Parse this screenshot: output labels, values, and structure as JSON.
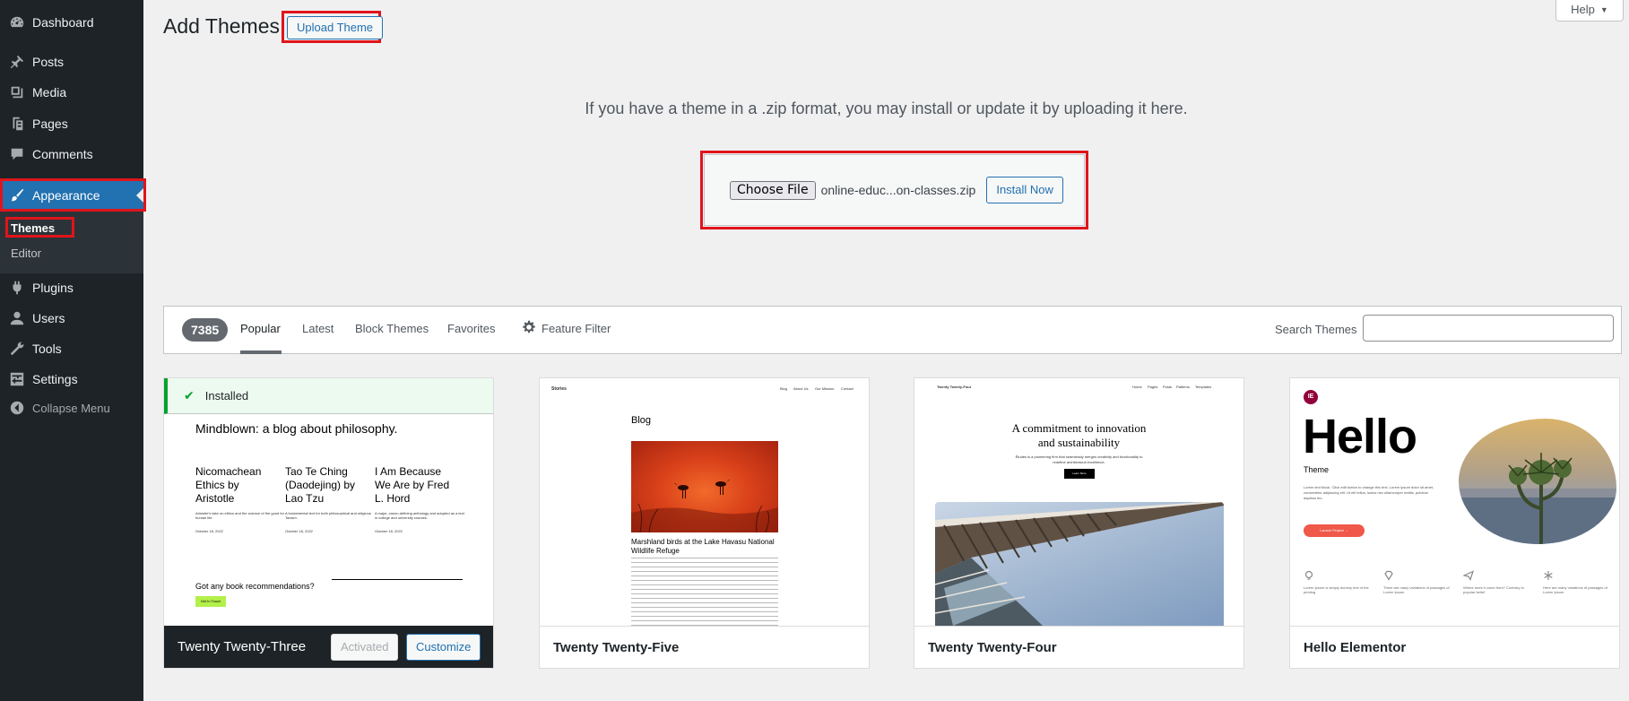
{
  "sidebar": {
    "items": [
      {
        "id": "dashboard",
        "label": "Dashboard",
        "icon": "dashboard-icon"
      },
      {
        "id": "posts",
        "label": "Posts",
        "icon": "pin-icon"
      },
      {
        "id": "media",
        "label": "Media",
        "icon": "media-icon"
      },
      {
        "id": "pages",
        "label": "Pages",
        "icon": "pages-icon"
      },
      {
        "id": "comments",
        "label": "Comments",
        "icon": "comment-icon"
      },
      {
        "id": "appearance",
        "label": "Appearance",
        "icon": "paintbrush-icon"
      },
      {
        "id": "plugins",
        "label": "Plugins",
        "icon": "plugin-icon"
      },
      {
        "id": "users",
        "label": "Users",
        "icon": "user-icon"
      },
      {
        "id": "tools",
        "label": "Tools",
        "icon": "wrench-icon"
      },
      {
        "id": "settings",
        "label": "Settings",
        "icon": "settings-icon"
      },
      {
        "id": "collapse",
        "label": "Collapse Menu",
        "icon": "collapse-icon"
      }
    ],
    "submenu": {
      "themes": "Themes",
      "editor": "Editor"
    }
  },
  "header": {
    "title": "Add Themes",
    "upload_label": "Upload Theme",
    "help_label": "Help"
  },
  "upload": {
    "description": "If you have a theme in a .zip format, you may install or update it by uploading it here.",
    "choose_label": "Choose File",
    "file_name": "online-educ...on-classes.zip",
    "install_label": "Install Now"
  },
  "filters": {
    "count": "7385",
    "tabs": [
      "Popular",
      "Latest",
      "Block Themes",
      "Favorites"
    ],
    "feature_filter": "Feature Filter",
    "search_label": "Search Themes",
    "search_value": ""
  },
  "themes": [
    {
      "name": "Twenty Twenty-Three",
      "installed_label": "Installed",
      "activated_label": "Activated",
      "customize_label": "Customize",
      "preview": {
        "title": "Mindblown: a blog about philosophy.",
        "books": [
          {
            "title": "Nicomachean Ethics by Aristotle",
            "text": "Aristotle's take on ethics and the science of the good for human life.",
            "date": "October 18, 2022"
          },
          {
            "title": "Tao Te Ching (Daodejing) by Lao Tzu",
            "text": "A fundamental text for both philosophical and religious Taoism.",
            "date": "October 18, 2022"
          },
          {
            "title": "I Am Because We Are by Fred L. Hord",
            "text": "A major, canon-defining anthology and adopted as a text in college and university courses.",
            "date": "October 18, 2022"
          }
        ],
        "question": "Got any book recommendations?",
        "button": "Get In Touch"
      }
    },
    {
      "name": "Twenty Twenty-Five",
      "preview": {
        "site": "Stories",
        "nav": [
          "Blog",
          "About Us",
          "Our Mission",
          "Contact"
        ],
        "heading": "Blog",
        "caption": "Marshland birds at the Lake Havasu National Wildlife Refuge"
      }
    },
    {
      "name": "Twenty Twenty-Four",
      "preview": {
        "site": "Twenty Twenty-Four",
        "nav": [
          "Home",
          "Pages",
          "Posts",
          "Patterns",
          "Templates"
        ],
        "heading": "A commitment to innovation and sustainability",
        "sub": "Études is a pioneering firm that seamlessly merges creativity and functionality to redefine architectural excellence.",
        "button": "Learn More"
      }
    },
    {
      "name": "Hello Elementor",
      "preview": {
        "logo": "IE",
        "hello": "Hello",
        "theme": "Theme",
        "desc": "Lorem text block. Click edit button to change this text. Lorem ipsum dolor sit amet, consectetur adipiscing elit. Ut elit tellus, luctus nec ullamcorper mattis, pulvinar dapibus leo.",
        "button": "Launch Project →",
        "features": [
          "Lorem Ipsum is simply dummy text of the printing",
          "There are many variations of passages of Lorem Ipsum",
          "Where does it come from? Contrary to popular belief",
          "Here are many variations of passages of Lorem Ipsum"
        ]
      }
    }
  ],
  "colors": {
    "admin_blue": "#2271b1",
    "sidebar_bg": "#1d2327",
    "highlight_red": "#e0141b",
    "installed_green": "#00a32a"
  }
}
